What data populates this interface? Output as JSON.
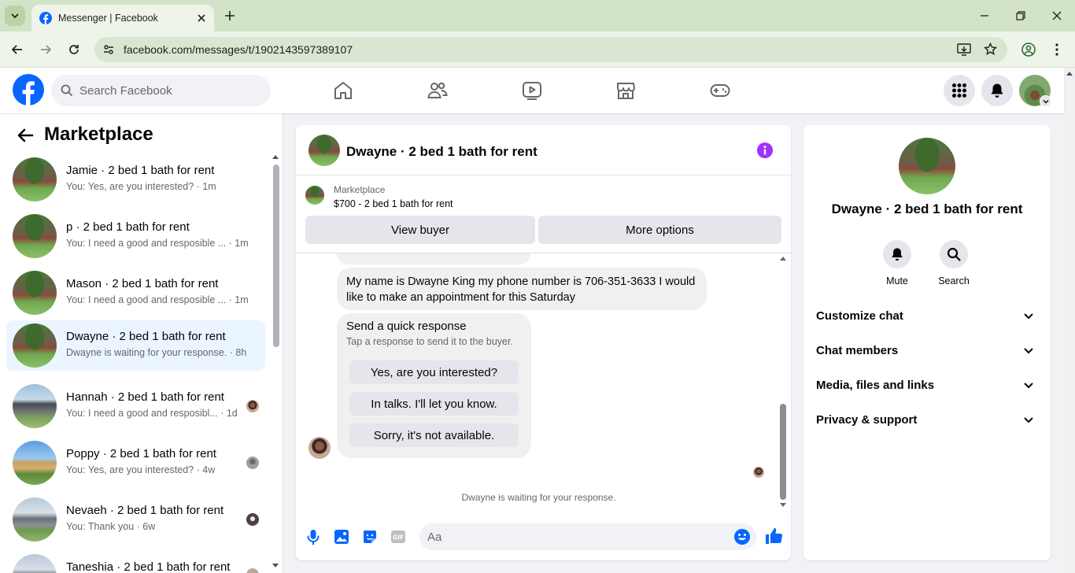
{
  "browser": {
    "tab_title": "Messenger | Facebook",
    "url": "facebook.com/messages/t/1902143597389107"
  },
  "header": {
    "search_placeholder": "Search Facebook"
  },
  "left_panel": {
    "title": "Marketplace",
    "conversations": [
      {
        "name": "Jamie · 2 bed 1 bath for rent",
        "preview": "You: Yes, are you interested? · 1m",
        "active": false
      },
      {
        "name": "p · 2 bed 1 bath for rent",
        "preview": "You: I need a good and resposible ... · 1m",
        "active": false
      },
      {
        "name": "Mason · 2 bed 1 bath for rent",
        "preview": "You: I need a good and resposible ... · 1m",
        "active": false
      },
      {
        "name": "Dwayne · 2 bed 1 bath for rent",
        "preview": "Dwayne is waiting for your response. · 8h",
        "active": true
      },
      {
        "name": "Hannah · 2 bed 1 bath for rent",
        "preview": "You: I need a good and resposibl... · 1d",
        "active": false
      },
      {
        "name": "Poppy · 2 bed 1 bath for rent",
        "preview": "You: Yes, are you interested? · 4w",
        "active": false
      },
      {
        "name": "Nevaeh · 2 bed 1 bath for rent",
        "preview": "You: Thank you · 6w",
        "active": false
      },
      {
        "name": "Taneshia · 2 bed 1 bath for rent",
        "preview": "",
        "active": false
      }
    ]
  },
  "chat": {
    "title": "Dwayne · 2 bed 1 bath for rent",
    "marketplace_label": "Marketplace",
    "listing": "$700 - 2 bed 1 bath for rent",
    "view_buyer": "View buyer",
    "more_options": "More options",
    "message": "My name is Dwayne King my phone number is 706-351-3633 I would like to make an appointment for this Saturday",
    "quick_response": {
      "title": "Send a quick response",
      "subtitle": "Tap a response to send it to the buyer.",
      "options": [
        "Yes, are you interested?",
        "In talks. I'll let you know.",
        "Sorry, it's not available."
      ]
    },
    "waiting": "Dwayne is waiting for your response.",
    "composer_placeholder": "Aa"
  },
  "right_panel": {
    "name": "Dwayne · 2 bed 1 bath for rent",
    "mute": "Mute",
    "search": "Search",
    "sections": [
      "Customize chat",
      "Chat members",
      "Media, files and links",
      "Privacy & support"
    ]
  },
  "colors": {
    "fb_blue": "#0866ff",
    "info_purple": "#a033ff",
    "chrome_green": "#d3e3c8"
  }
}
